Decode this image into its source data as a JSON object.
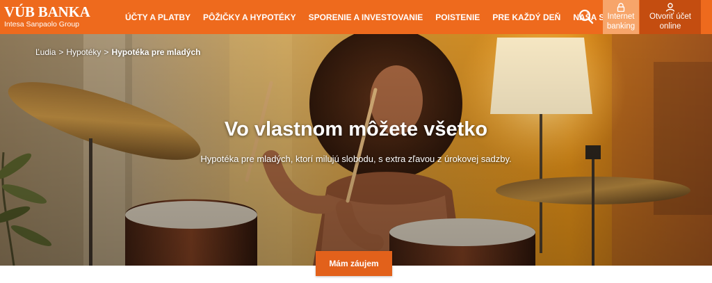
{
  "header": {
    "logo": {
      "name": "VÚB BANKA",
      "tagline": "Intesa Sanpaolo Group"
    },
    "nav": [
      {
        "label": "ÚČTY A PLATBY"
      },
      {
        "label": "PÔŽIČKY A HYPOTÉKY"
      },
      {
        "label": "SPORENIE A INVESTOVANIE"
      },
      {
        "label": "POISTENIE"
      },
      {
        "label": "PRE KAŽDÝ DEŇ"
      },
      {
        "label": "NAŠA SKUPINA"
      }
    ],
    "search_icon": "search-icon",
    "internet_banking": {
      "line1": "Internet",
      "line2": "banking",
      "icon": "lock-icon"
    },
    "open_account": {
      "line1": "Otvoriť účet",
      "line2": "online",
      "icon": "user-icon"
    }
  },
  "breadcrumb": [
    {
      "label": "Ľudia"
    },
    {
      "label": "Hypotéky"
    },
    {
      "label": "Hypotéka pre mladých"
    }
  ],
  "breadcrumb_separator": ">",
  "hero": {
    "title": "Vo vlastnom môžete všetko",
    "subtitle": "Hypotéka pre mladých, ktorí milujú slobodu, s extra zľavou z úrokovej sadzby.",
    "cta_label": "Mám záujem"
  },
  "colors": {
    "brand_orange": "#ee6a1d",
    "internet_banking_bg": "#f7a56a",
    "open_account_bg": "#c44d10",
    "cta_bg": "#e2611b"
  }
}
